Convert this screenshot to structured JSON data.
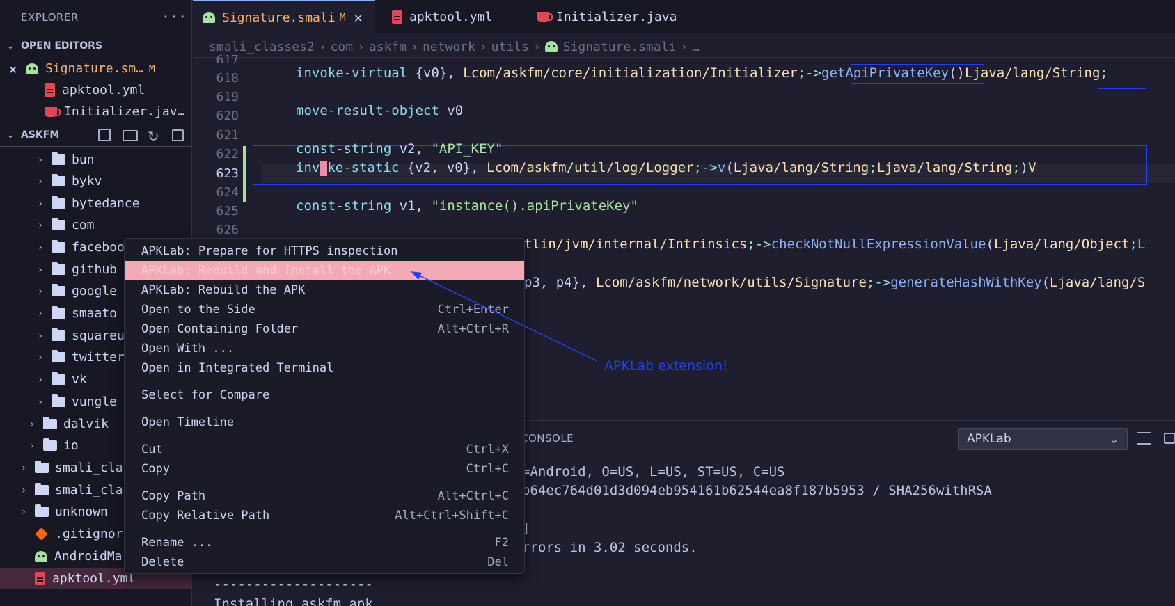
{
  "sidebar": {
    "title": "EXPLORER",
    "more": "···",
    "open_editors": {
      "heading": "OPEN EDITORS",
      "items": [
        {
          "label": "Signature.sm…",
          "badge": "M"
        },
        {
          "label": "apktool.yml"
        },
        {
          "label": "Initializer.jav…"
        }
      ]
    },
    "project": {
      "heading": "ASKFM",
      "folders": [
        "bun",
        "bykv",
        "bytedance",
        "com",
        "faceboo",
        "github",
        "google",
        "smaato",
        "squareu",
        "twitter",
        "vk",
        "vungle"
      ],
      "outer_folders": [
        "dalvik",
        "io"
      ],
      "top_folders": [
        "smali_cla",
        "smali_cla",
        "unknown"
      ],
      "files": [
        ".gitignor",
        "AndroidMa",
        "apktool.yml"
      ]
    }
  },
  "tabs": [
    {
      "label": "Signature.smali",
      "badge": "M"
    },
    {
      "label": "apktool.yml"
    },
    {
      "label": "Initializer.java"
    }
  ],
  "breadcrumb": [
    "smali_classes2",
    "com",
    "askfm",
    "network",
    "utils",
    "Signature.smali",
    "…"
  ],
  "editor": {
    "line_numbers": [
      "617",
      "618",
      "619",
      "620",
      "621",
      "622",
      "623",
      "624",
      "625",
      "626"
    ],
    "l618": {
      "a": "invoke-virtual ",
      "b": "{v0}, ",
      "c": "L",
      "d": "com/askfm/core/initialization/Initializer",
      "e": ";->",
      "f": "getApiPrivateKey",
      "g": "()",
      "h": "L",
      "i": "java/lang/String",
      "j": ";"
    },
    "l620": {
      "a": "move-result-object ",
      "b": "v0"
    },
    "l622": {
      "a": "const-string ",
      "b": "v2, ",
      "c": "\"API_KEY\""
    },
    "l623": {
      "a": "inv",
      "b": "ke-static ",
      "c": "{v2, v0}, ",
      "d": "L",
      "e": "com/askfm/util/log/Logger",
      "f": ";->",
      "g": "v",
      "h": "(",
      "i": "L",
      "j": "java/lang/String",
      "k": ";",
      "l": "L",
      "m": "java/lang/String",
      "n": ";",
      "o": ")",
      "p": "V"
    },
    "l625": {
      "a": "const-string ",
      "b": "v1, ",
      "c": "\"instance().apiPrivateKey\""
    },
    "l627": {
      "a": "tlin/jvm/internal/Intrinsics",
      "b": ";->",
      "c": "checkNotNullExpressionValue",
      "d": "(",
      "e": "L",
      "f": "java/lang/Object",
      "g": ";L"
    },
    "l629": {
      "a": "p3, p4}, ",
      "b": "L",
      "c": "com/askfm/network/utils/Signature",
      "d": ";->",
      "e": "generateHashWithKey",
      "f": "(",
      "g": "L",
      "h": "java/lang/S"
    }
  },
  "panel": {
    "tab_console": "CONSOLE",
    "channel": "APKLab",
    "lines": [
      "=Android, O=US, L=US, ST=US, C=US",
      "b64ec764d01d3d094eb954161b62544ea8f187b5953 / SHA256withRSA",
      "]",
      "rrors in 3.02 seconds.",
      "--------------------",
      "Installing askfm.apk"
    ]
  },
  "context_menu": {
    "items": [
      {
        "label": "APKLab: Prepare for HTTPS inspection",
        "shortcut": ""
      },
      {
        "label": "APKLab: Rebuild and Install the APK",
        "shortcut": ""
      },
      {
        "label": "APKLab: Rebuild the APK",
        "shortcut": ""
      },
      {
        "label": "Open to the Side",
        "shortcut": "Ctrl+Enter"
      },
      {
        "label": "Open Containing Folder",
        "shortcut": "Alt+Ctrl+R"
      },
      {
        "label": "Open With ...",
        "shortcut": ""
      },
      {
        "label": "Open in Integrated Terminal",
        "shortcut": ""
      },
      {
        "label": "Select for Compare",
        "shortcut": ""
      },
      {
        "label": "Open Timeline",
        "shortcut": ""
      },
      {
        "label": "Cut",
        "shortcut": "Ctrl+X"
      },
      {
        "label": "Copy",
        "shortcut": "Ctrl+C"
      },
      {
        "label": "Copy Path",
        "shortcut": "Alt+Ctrl+C"
      },
      {
        "label": "Copy Relative Path",
        "shortcut": "Alt+Ctrl+Shift+C"
      },
      {
        "label": "Rename ...",
        "shortcut": "F2"
      },
      {
        "label": "Delete",
        "shortcut": "Del"
      }
    ]
  },
  "annotation": "APKLab extension!",
  "colors": {
    "accent": "#89b4fa",
    "highlight": "#f4aab4",
    "annotation": "#1e40ff",
    "modified": "#f9b06b"
  }
}
